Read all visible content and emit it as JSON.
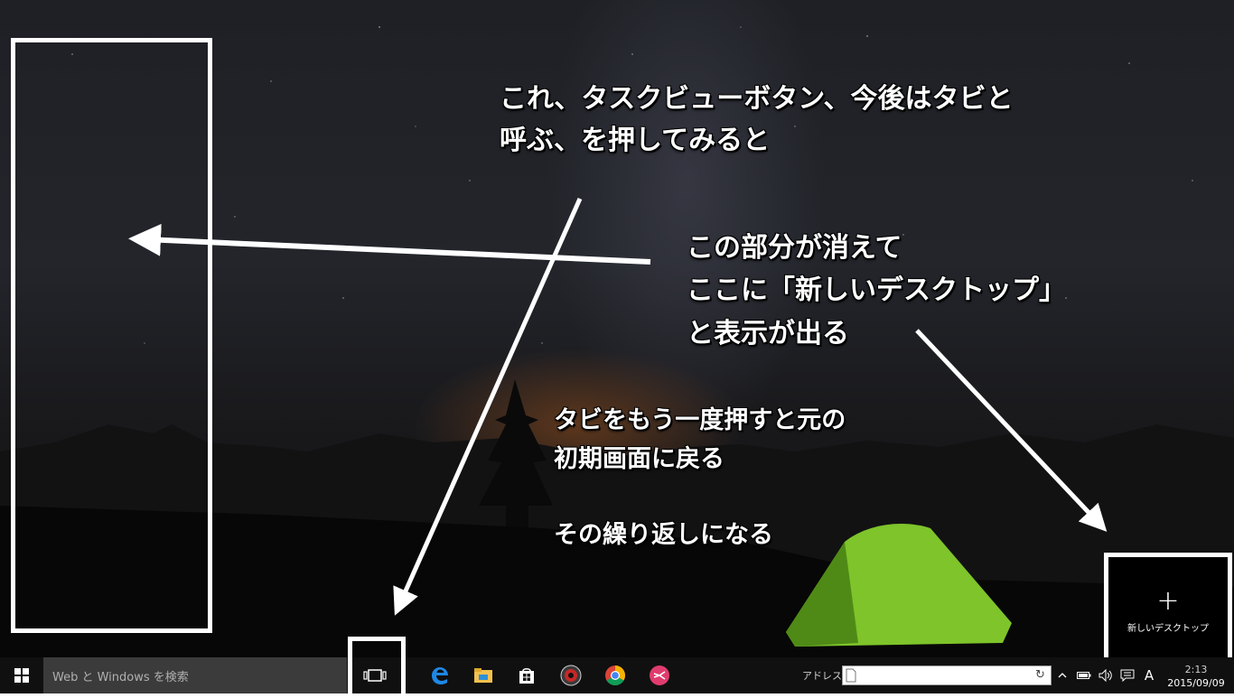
{
  "annotations": {
    "task_view_note_line1": "これ、タスクビューボタン、今後はタビと",
    "task_view_note_line2": "呼ぶ、を押してみると",
    "disappear_note_line1": "この部分が消えて",
    "disappear_note_line2": "ここに「新しいデスクトップ」",
    "disappear_note_line3": "と表示が出る",
    "press_again_line1": "タビをもう一度押すと元の",
    "press_again_line2": "初期画面に戻る",
    "repeat_note": "その繰り返しになる"
  },
  "new_desktop": {
    "plus": "+",
    "label": "新しいデスクトップ"
  },
  "taskbar": {
    "search_placeholder": "Web と Windows を検索",
    "address_label": "アドレス",
    "refresh_glyph": "↻",
    "tray_chevron": "^",
    "ime_indicator": "A",
    "time": "2:13",
    "date": "2015/09/09"
  },
  "icons": {
    "start": "windows-logo-icon",
    "task_view": "task-view-icon",
    "edge": "edge-icon",
    "explorer": "file-explorer-icon",
    "store": "store-icon",
    "media": "media-player-icon",
    "chrome": "chrome-icon",
    "app": "pinned-app-icon"
  },
  "colors": {
    "taskbar": "#101010",
    "search_box": "#3b3b3b",
    "annotation_text": "#ffffff",
    "tent_green": "#7ec42a",
    "edge_blue": "#1e88e5",
    "store_white": "#ffffff"
  }
}
